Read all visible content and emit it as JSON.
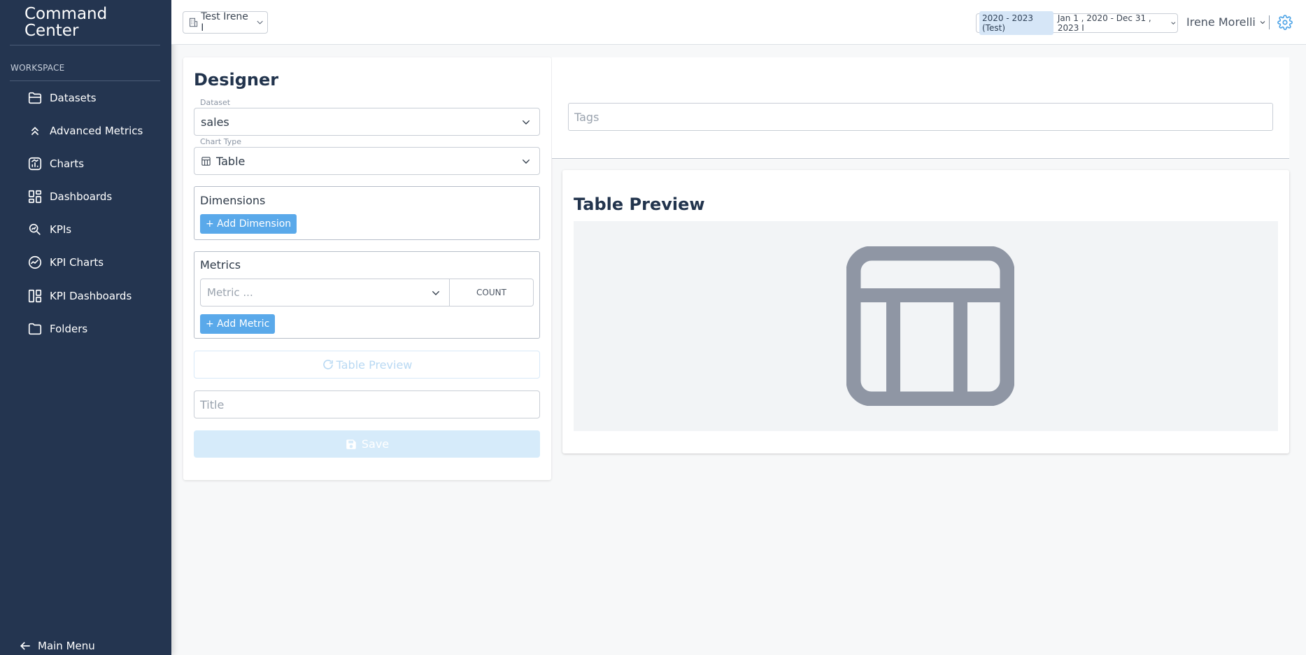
{
  "sidebar": {
    "brand": "Command\nCenter",
    "brand_line1": "Command",
    "brand_line2": "Center",
    "section_label": "WORKSPACE",
    "items": [
      {
        "label": "Datasets",
        "icon": "folder-open-icon"
      },
      {
        "label": "Advanced Metrics",
        "icon": "double-chevron-up-icon"
      },
      {
        "label": "Charts",
        "icon": "chart-icon"
      },
      {
        "label": "Dashboards",
        "icon": "dashboard-grid-icon"
      },
      {
        "label": "KPIs",
        "icon": "kpi-search-icon"
      },
      {
        "label": "KPI Charts",
        "icon": "kpi-gauge-icon"
      },
      {
        "label": "KPI Dashboards",
        "icon": "kpi-dashboard-icon"
      },
      {
        "label": "Folders",
        "icon": "folder-icon"
      }
    ],
    "main_menu": "Main Menu"
  },
  "topbar": {
    "org": "Test Irene I",
    "date_badge": "2020 - 2023 (Test)",
    "date_range": "Jan 1 , 2020 - Dec 31 , 2023 I",
    "user": "Irene Morelli",
    "accent": "#4da3e6"
  },
  "designer": {
    "title": "Designer",
    "dataset_label": "Dataset",
    "dataset_value": "sales",
    "chart_type_label": "Chart Type",
    "chart_type_value": "Table",
    "dimensions_title": "Dimensions",
    "add_dimension": "+ Add Dimension",
    "metrics_title": "Metrics",
    "metric_placeholder": "Metric ...",
    "aggregation": "COUNT",
    "add_metric": "+ Add Metric",
    "table_preview_button": "Table Preview",
    "title_placeholder": "Title",
    "save": "Save"
  },
  "right": {
    "tags_placeholder": "Tags",
    "preview_title": "Table Preview",
    "preview_icon": "table-icon"
  }
}
